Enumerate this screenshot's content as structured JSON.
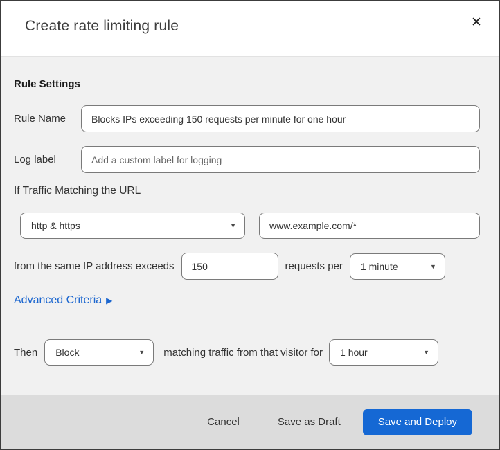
{
  "dialog": {
    "title": "Create rate limiting rule"
  },
  "icons": {
    "close": "✕",
    "caret": "▼",
    "advanced_arrow": "▶"
  },
  "colors": {
    "accent_blue": "#1568d4",
    "link_blue": "#1b66cf",
    "body_bg": "#f1f1f1",
    "footer_bg": "#dcdcdc",
    "top_sliver_red": "#d62b28",
    "top_sliver_dark": "#0e1c29"
  },
  "rule_settings": {
    "heading": "Rule Settings",
    "rule_name": {
      "label": "Rule Name",
      "value": "Blocks IPs exceeding 150 requests per minute for one hour"
    },
    "log_label": {
      "label": "Log label",
      "placeholder": "Add a custom label for logging"
    }
  },
  "traffic_match": {
    "heading": "If Traffic Matching the URL",
    "scheme_select": {
      "value": "http & https"
    },
    "url_input": {
      "value": "www.example.com/*"
    },
    "threshold": {
      "prefix": "from the same IP address exceeds",
      "requests_value": "150",
      "middle": "requests per",
      "period_select": {
        "value": "1 minute"
      }
    },
    "advanced_link": {
      "label": "Advanced Criteria"
    }
  },
  "action": {
    "prefix": "Then",
    "action_select": {
      "value": "Block"
    },
    "middle": "matching traffic from that visitor for",
    "duration_select": {
      "value": "1 hour"
    }
  },
  "footer": {
    "cancel": "Cancel",
    "save_draft": "Save as Draft",
    "save_deploy": "Save and Deploy"
  }
}
